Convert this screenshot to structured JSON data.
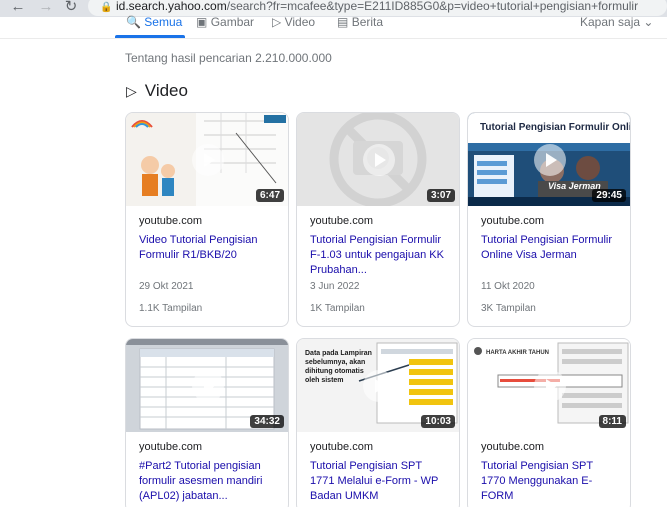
{
  "browser": {
    "url_host": "id.search.yahoo.com",
    "url_rest": "/search?fr=mcafee&type=E211ID885G0&p=video+tutorial+pengisian+formulir"
  },
  "tabs": {
    "all": "Semua",
    "images": "Gambar",
    "video": "Video",
    "news": "Berita",
    "anytime": "Kapan saja"
  },
  "result_count": "Tentang hasil pencarian 2.210.000.000",
  "section_title": "Video",
  "videos": [
    {
      "duration": "6:47",
      "source": "youtube.com",
      "title": "Video Tutorial Pengisian Formulir R1/BKB/20",
      "date": "29 Okt 2021",
      "views": "1.1K Tampilan"
    },
    {
      "duration": "3:07",
      "source": "youtube.com",
      "title": "Tutorial Pengisian Formulir F-1.03 untuk pengajuan KK Prubahan...",
      "date": "3 Jun 2022",
      "views": "1K Tampilan"
    },
    {
      "duration": "29:45",
      "source": "youtube.com",
      "title": "Tutorial Pengisian Formulir Online Visa Jerman",
      "date": "11 Okt 2020",
      "views": "3K Tampilan",
      "thumb_heading": "Tutorial Pengisian Formulir Online",
      "thumb_caption": "Visa Jerman"
    },
    {
      "duration": "34:32",
      "source": "youtube.com",
      "title": "#Part2 Tutorial pengisian formulir asesmen mandiri (APL02) jabatan..."
    },
    {
      "duration": "10:03",
      "source": "youtube.com",
      "title": "Tutorial Pengisian SPT 1771 Melalui e-Form - WP Badan UMKM",
      "thumb_text": "Data pada Lampiran sebelumnya, akan dihitung otomatis oleh sistem"
    },
    {
      "duration": "8:11",
      "source": "youtube.com",
      "title": "Tutorial Pengisian SPT 1770 Menggunakan E-FORM",
      "thumb_text": "HARTA AKHIR TAHUN"
    }
  ]
}
